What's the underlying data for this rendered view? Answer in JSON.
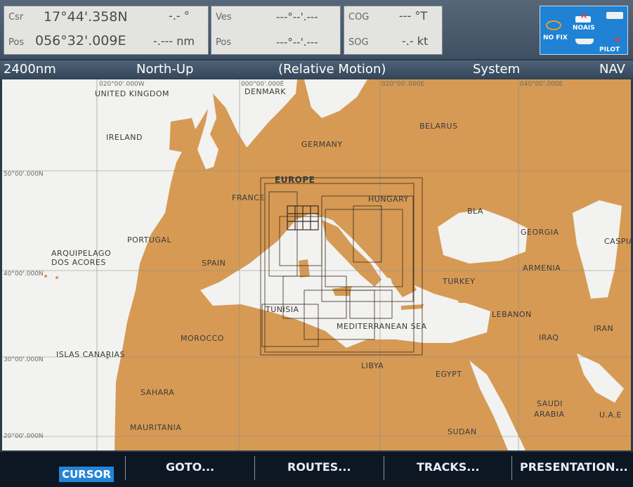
{
  "panels": {
    "csr": {
      "label": "Csr",
      "value": "17°44'.358N",
      "extra": "-.- °"
    },
    "pos1": {
      "label": "Pos",
      "value": "056°32'.009E",
      "extra": "-.--- nm"
    },
    "ves": {
      "label": "Ves",
      "value": "---°--'.---"
    },
    "pos2": {
      "label": "Pos",
      "value": "---°--'.---"
    },
    "cog": {
      "label": "COG",
      "value": "--- °T"
    },
    "sog": {
      "label": "SOG",
      "value": "-.- kt"
    }
  },
  "status_box": {
    "nofix": "NO FIX",
    "noais": "NOAIS",
    "pilot": "PILOT"
  },
  "status_bar": {
    "range": "2400nm",
    "orientation": "North-Up",
    "motion": "(Relative Motion)",
    "system": "System",
    "mode": "NAV"
  },
  "map": {
    "grid_labels": {
      "lon_020w": "020°00'.000W",
      "lon_000": "000°00'.000E",
      "lon_020e": "020°00'.000E",
      "lon_040e": "040°00'.000E",
      "lat_50": "50°00'.000N",
      "lat_40": "40°00'.000N",
      "lat_30": "30°00'.000N",
      "lat_20": "20°00'.000N"
    },
    "labels": {
      "uk": "UNITED KINGDOM",
      "denmark": "DENMARK",
      "ireland": "IRELAND",
      "belarus": "BELARUS",
      "germany": "GERMANY",
      "europe": "EUROPE",
      "france": "FRANCE",
      "hungary": "HUNGARY",
      "portugal": "PORTUGAL",
      "georgia": "GEORGIA",
      "caspian": "CASPIA",
      "azores1": "ARQUIPELAGO",
      "azores2": "DOS ACORES",
      "spain": "SPAIN",
      "armenia": "ARMENIA",
      "turkey": "TURKEY",
      "tunisia": "TUNISIA",
      "lebanon": "LEBANON",
      "iran": "IRAN",
      "med": "MEDITERRANEAN SEA",
      "morocco": "MOROCCO",
      "iraq": "IRAQ",
      "canarias": "ISLAS CANARIAS",
      "libya": "LIBYA",
      "egypt": "EGYPT",
      "sahara": "SAHARA",
      "saudi1": "SAUDI",
      "saudi2": "ARABIA",
      "uae": "U.A.E",
      "mauritania": "MAURITANIA",
      "sudan": "SUDAN",
      "blacksea": "BLA"
    }
  },
  "buttons": {
    "cursor": "CURSOR",
    "goto": "GOTO...",
    "routes": "ROUTES...",
    "tracks": "TRACKS...",
    "presentation": "PRESENTATION..."
  },
  "colors": {
    "land": "#d69a55",
    "sea": "#f2f2f0",
    "accent": "#2485d6"
  }
}
